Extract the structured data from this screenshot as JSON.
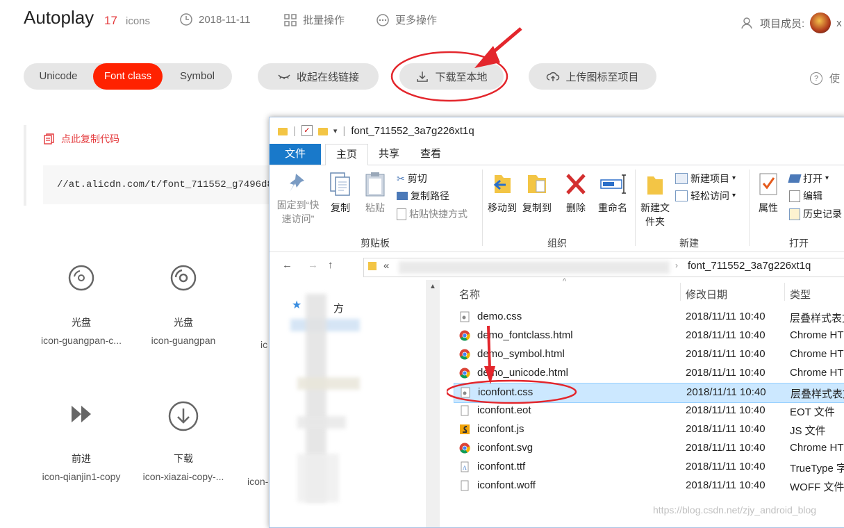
{
  "header": {
    "title": "Autoplay",
    "count": "17",
    "count_unit": "icons",
    "date": "2018-11-11",
    "batch": "批量操作",
    "more": "更多操作",
    "members": "项目成员:",
    "member_initial": "x"
  },
  "tabs": {
    "unicode": "Unicode",
    "font_class": "Font class",
    "symbol": "Symbol"
  },
  "actions": {
    "collapse_link": "收起在线链接",
    "download": "下载至本地",
    "upload": "上传图标至项目",
    "help": "使"
  },
  "copy_panel": {
    "copy_label": "点此复制代码",
    "code": "//at.alicdn.com/t/font_711552_g7496d8"
  },
  "icons": [
    {
      "name": "光盘",
      "class": "icon-guangpan-c...",
      "glyph": "disc-icon"
    },
    {
      "name": "光盘",
      "class": "icon-guangpan",
      "glyph": "disc-outline-icon"
    },
    {
      "name": "",
      "class": "ic",
      "glyph": ""
    },
    {
      "name": "前进",
      "class": "icon-qianjin1-copy",
      "glyph": "fast-forward-icon"
    },
    {
      "name": "下载",
      "class": "icon-xiazai-copy-...",
      "glyph": "download-circle-icon"
    },
    {
      "name": "",
      "class": "icon-",
      "glyph": ""
    }
  ],
  "explorer": {
    "title": "font_711552_3a7g226xt1q",
    "tabs": {
      "file": "文件",
      "home": "主页",
      "share": "共享",
      "view": "查看"
    },
    "ribbon": {
      "pin": "固定到“快速访问”",
      "copy": "复制",
      "paste": "粘贴",
      "cut": "剪切",
      "copy_path": "复制路径",
      "paste_shortcut": "粘贴快捷方式",
      "clipboard": "剪贴板",
      "move_to": "移动到",
      "copy_to": "复制到",
      "delete": "删除",
      "rename": "重命名",
      "organize": "组织",
      "new_folder": "新建文件夹",
      "new_item": "新建项目",
      "easy_access": "轻松访问",
      "new": "新建",
      "properties": "属性",
      "open": "打开",
      "edit": "编辑",
      "history": "历史记录",
      "open_group": "打开"
    },
    "address": {
      "prefix": "«",
      "path": "font_711552_3a7g226xt1q"
    },
    "columns": {
      "name": "名称",
      "date": "修改日期",
      "type": "类型"
    },
    "files": [
      {
        "name": "demo.css",
        "date": "2018/11/11 10:40",
        "type": "层叠样式表文",
        "icon": "css-file-icon"
      },
      {
        "name": "demo_fontclass.html",
        "date": "2018/11/11 10:40",
        "type": "Chrome HT",
        "icon": "chrome-icon"
      },
      {
        "name": "demo_symbol.html",
        "date": "2018/11/11 10:40",
        "type": "Chrome HT",
        "icon": "chrome-icon"
      },
      {
        "name": "demo_unicode.html",
        "date": "2018/11/11 10:40",
        "type": "Chrome HT",
        "icon": "chrome-icon"
      },
      {
        "name": "iconfont.css",
        "date": "2018/11/11 10:40",
        "type": "层叠样式表文",
        "icon": "css-file-icon"
      },
      {
        "name": "iconfont.eot",
        "date": "2018/11/11 10:40",
        "type": "EOT 文件",
        "icon": "blank-file-icon"
      },
      {
        "name": "iconfont.js",
        "date": "2018/11/11 10:40",
        "type": "JS 文件",
        "icon": "js-file-icon"
      },
      {
        "name": "iconfont.svg",
        "date": "2018/11/11 10:40",
        "type": "Chrome HT",
        "icon": "chrome-icon"
      },
      {
        "name": "iconfont.ttf",
        "date": "2018/11/11 10:40",
        "type": "TrueType 字",
        "icon": "font-file-icon"
      },
      {
        "name": "iconfont.woff",
        "date": "2018/11/11 10:40",
        "type": "WOFF 文件",
        "icon": "blank-file-icon"
      }
    ],
    "nav_text": "方"
  },
  "watermark": "https://blog.csdn.net/zjy_android_blog",
  "colors": {
    "accent": "#ff2200",
    "annotation": "#e3262c",
    "selection": "#cce8ff",
    "ribbon_file": "#1979ca"
  }
}
